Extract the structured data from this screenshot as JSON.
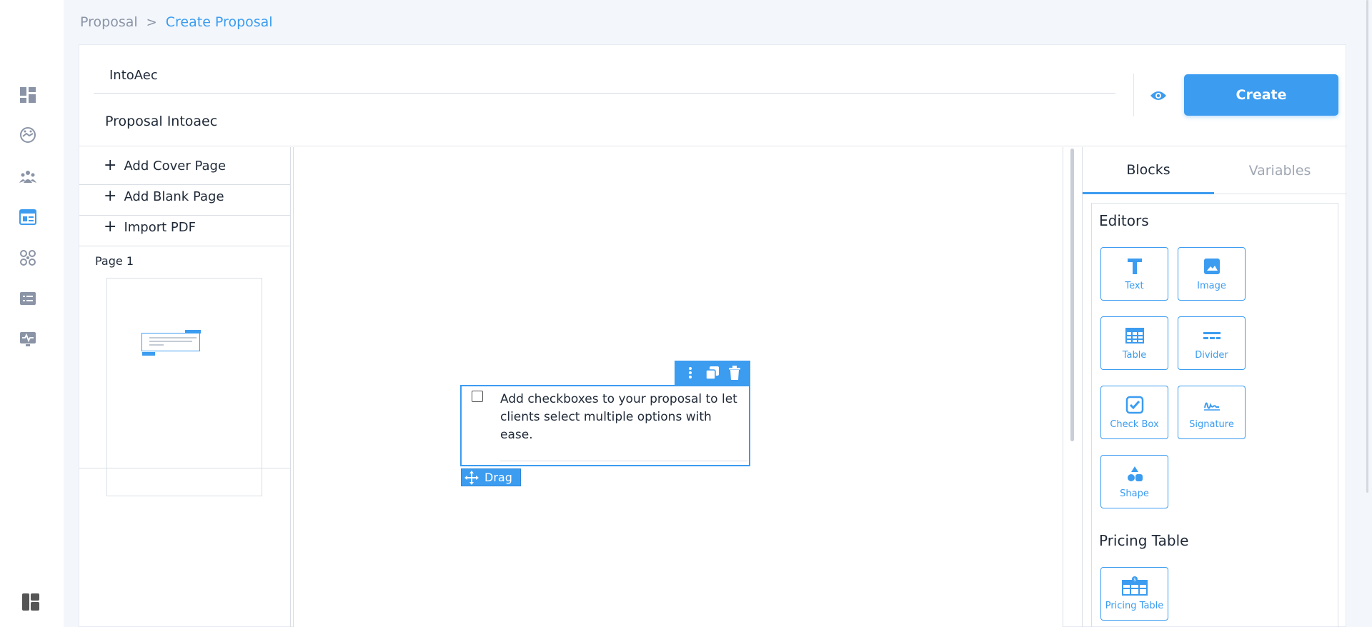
{
  "nav": {
    "items": [
      {
        "icon": "dashboard-icon"
      },
      {
        "icon": "handshake-icon"
      },
      {
        "icon": "team-icon"
      },
      {
        "icon": "proposal-template-icon",
        "active": true
      },
      {
        "icon": "integrations-icon"
      },
      {
        "icon": "list-icon"
      },
      {
        "icon": "activity-monitor-icon"
      }
    ],
    "bottom_icon": "layout-toggle-icon"
  },
  "breadcrumb": {
    "parent": "Proposal",
    "current": "Create Proposal"
  },
  "header": {
    "client_name": "IntoAec",
    "proposal_title": "Proposal Intoaec",
    "create_label": "Create"
  },
  "pages_panel": {
    "add_cover_label": "Add Cover Page",
    "add_blank_label": "Add Blank Page",
    "import_pdf_label": "Import PDF",
    "page_label": "Page 1"
  },
  "canvas": {
    "checkbox_block_text": "Add checkboxes to your proposal to let clients select multiple options with ease.",
    "drag_label": "Drag"
  },
  "right_panel": {
    "tab_blocks": "Blocks",
    "tab_variables": "Variables",
    "editors_heading": "Editors",
    "editors": [
      {
        "label": "Text",
        "icon": "text-icon"
      },
      {
        "label": "Image",
        "icon": "image-icon"
      },
      {
        "label": "Table",
        "icon": "table-icon"
      },
      {
        "label": "Divider",
        "icon": "divider-icon"
      },
      {
        "label": "Check Box",
        "icon": "checkbox-icon"
      },
      {
        "label": "Signature",
        "icon": "signature-icon"
      },
      {
        "label": "Shape",
        "icon": "shape-icon"
      }
    ],
    "pricing_heading": "Pricing Table",
    "pricing_items": [
      {
        "label": "Pricing Table",
        "icon": "pricing-table-icon"
      }
    ]
  },
  "colors": {
    "accent": "#3b9cf0",
    "nav_icon": "#8a94a6",
    "text": "#1f2937",
    "border": "#d9dee5"
  }
}
